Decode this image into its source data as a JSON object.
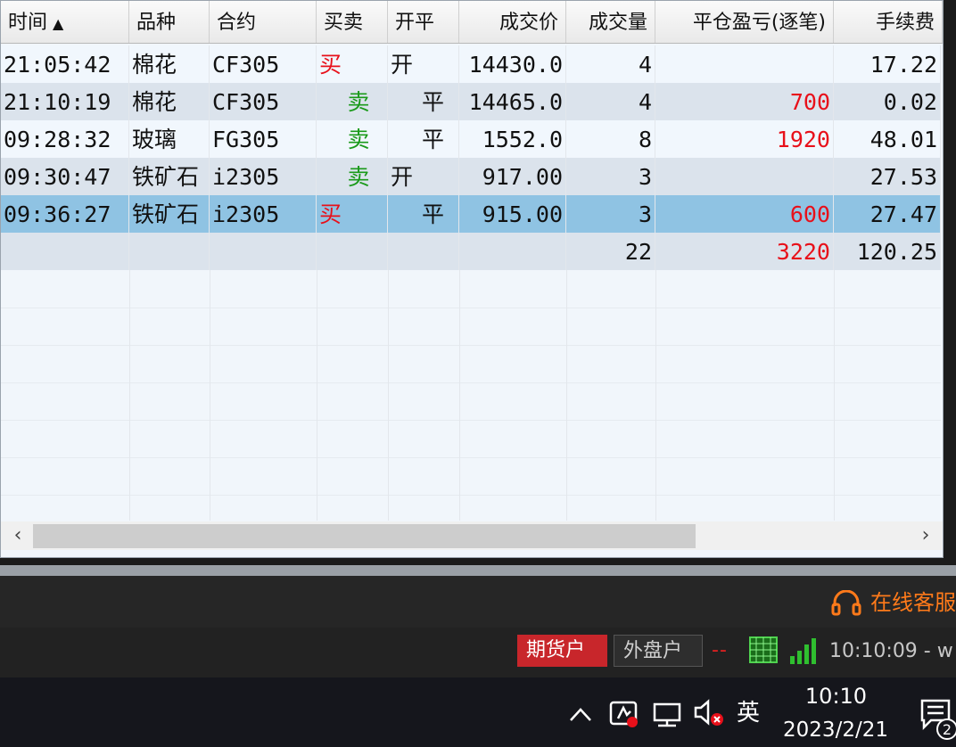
{
  "grid": {
    "columns": [
      {
        "label": "时间",
        "sort_indicator": "▲"
      },
      {
        "label": "品种"
      },
      {
        "label": "合约"
      },
      {
        "label": "买卖"
      },
      {
        "label": "开平"
      },
      {
        "label": "成交价"
      },
      {
        "label": "成交量"
      },
      {
        "label": "平仓盈亏(逐笔)"
      },
      {
        "label": "手续费"
      }
    ],
    "rows": [
      {
        "time": "21:05:42",
        "variety": "棉花",
        "contract": "CF305",
        "side": "买",
        "open_close": "开",
        "price": "14430.0",
        "volume": "4",
        "pnl": "",
        "fee": "17.22"
      },
      {
        "time": "21:10:19",
        "variety": "棉花",
        "contract": "CF305",
        "side": "卖",
        "open_close": "平",
        "price": "14465.0",
        "volume": "4",
        "pnl": "700",
        "fee": "0.02"
      },
      {
        "time": "09:28:32",
        "variety": "玻璃",
        "contract": "FG305",
        "side": "卖",
        "open_close": "平",
        "price": "1552.0",
        "volume": "8",
        "pnl": "1920",
        "fee": "48.01"
      },
      {
        "time": "09:30:47",
        "variety": "铁矿石",
        "contract": "i2305",
        "side": "卖",
        "open_close": "开",
        "price": "917.00",
        "volume": "3",
        "pnl": "",
        "fee": "27.53"
      },
      {
        "time": "09:36:27",
        "variety": "铁矿石",
        "contract": "i2305",
        "side": "买",
        "open_close": "平",
        "price": "915.00",
        "volume": "3",
        "pnl": "600",
        "fee": "27.47"
      }
    ],
    "total": {
      "volume": "22",
      "pnl": "3220",
      "fee": "120.25"
    },
    "selected_row": 4
  },
  "app_footer": {
    "service_label": "在线客服",
    "futures_account": "期货户",
    "foreign_account": "外盘户",
    "connection_indicator": "--",
    "status_time": "10:10:09 - w"
  },
  "taskbar": {
    "ime": "英",
    "time": "10:10",
    "date": "2023/2/21",
    "notification_count": "2"
  },
  "colors": {
    "buy": "#e8101a",
    "sell": "#1a9a1a",
    "profit": "#e8101a",
    "selected_row": "#8fc3e3",
    "futures_account_bg": "#c8262b",
    "service_orange": "#ff7a1a"
  },
  "icons": [
    "sort-up-icon",
    "scroll-left-icon",
    "scroll-right-icon",
    "headset-icon",
    "grid-status-icon",
    "signal-bars-icon",
    "chevron-up-icon",
    "app-tray-icon",
    "network-icon",
    "volume-muted-icon",
    "notification-icon"
  ]
}
